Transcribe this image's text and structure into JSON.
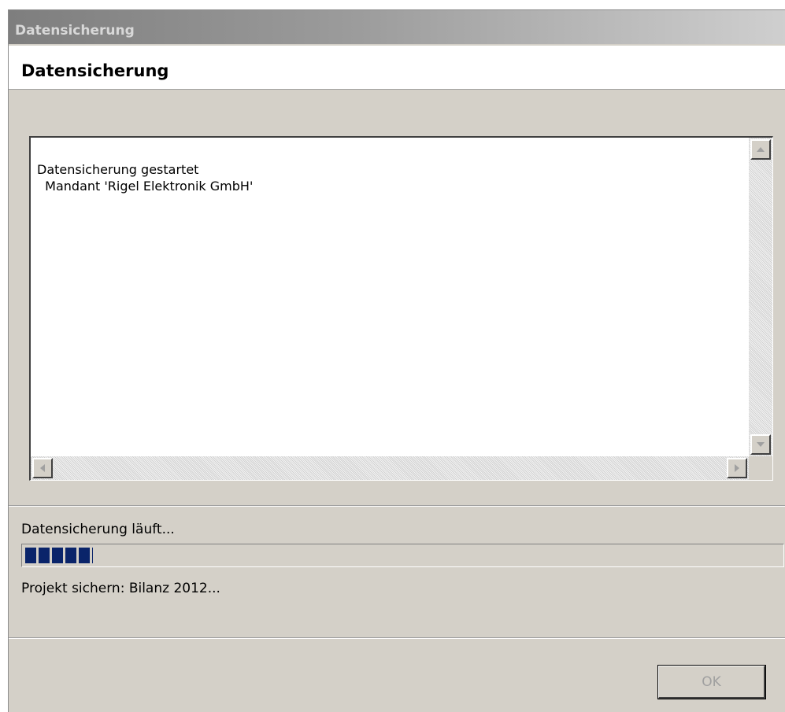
{
  "window": {
    "title": "Datensicherung"
  },
  "header": {
    "title": "Datensicherung"
  },
  "log": {
    "lines": [
      "Datensicherung gestartet",
      "  Mandant 'Rigel Elektronik GmbH'"
    ]
  },
  "status": {
    "text": "Datensicherung läuft...",
    "progress_fraction": 0.09,
    "detail": "Projekt sichern: Bilanz 2012..."
  },
  "buttons": {
    "ok": "OK",
    "ok_enabled": false
  },
  "colors": {
    "progress_fill": "#0a246a",
    "window_bg": "#d4d0c8",
    "disabled_text": "#a0a0a0"
  },
  "icons": [
    "scroll-up-icon",
    "scroll-down-icon",
    "scroll-left-icon",
    "scroll-right-icon"
  ]
}
